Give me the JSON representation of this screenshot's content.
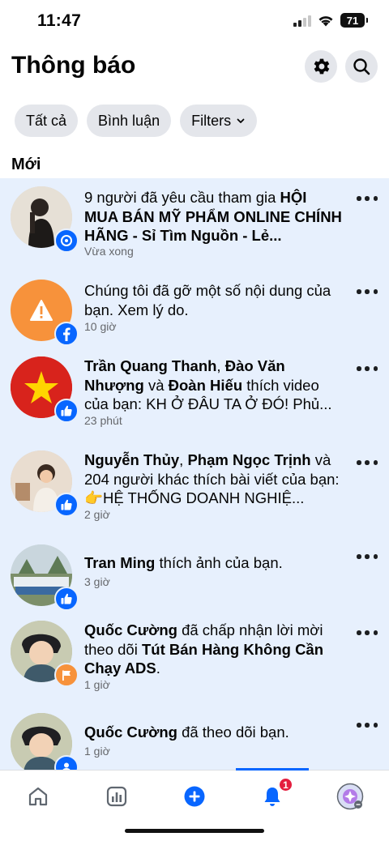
{
  "status_bar": {
    "time": "11:47",
    "battery": "71"
  },
  "header": {
    "title": "Thông báo",
    "settings_icon": "gear-icon",
    "search_icon": "search-icon"
  },
  "filters": {
    "all": "Tất cả",
    "comments": "Bình luận",
    "filters": "Filters"
  },
  "section": {
    "new": "Mới"
  },
  "notifications": [
    {
      "lines": [
        "9 người đã yêu cầu tham gia <b>HỘI</b>",
        "<b>MUA BÁN MỸ PHẨM ONLINE</b>",
        "<b>CHÍNH HÃNG - Sỉ Tìm Nguồn - Lẻ...</b>"
      ],
      "plain": "9 người đã yêu cầu tham gia HỘI MUA BÁN MỸ PHẨM ONLINE CHÍNH HÃNG - Sỉ Tìm Nguồn - Lẻ...",
      "time": "Vừa xong",
      "badge": "group-icon",
      "badge_color": "#0866ff"
    },
    {
      "plain": "Chúng tôi đã gỡ một số nội dung của bạn. Xem lý do.",
      "time": "10 giờ",
      "badge": "facebook-icon",
      "badge_color": "#0866ff",
      "avatar_color": "#f7923b"
    },
    {
      "plain": "Trần Quang Thanh, Đào Văn Nhượng và Đoàn Hiếu thích video của bạn: KH Ở ĐÂU TA Ở ĐÓ! Phủ...",
      "time": "23 phút",
      "badge": "like-icon",
      "badge_color": "#0866ff"
    },
    {
      "plain": "Nguyễn Thủy, Phạm Ngọc Trịnh và 204 người khác thích bài viết của bạn: 👉HỆ THỐNG DOANH NGHIỆ...",
      "time": "2 giờ",
      "badge": "like-icon",
      "badge_color": "#0866ff"
    },
    {
      "plain": "Tran Ming thích ảnh của bạn.",
      "time": "3 giờ",
      "badge": "like-icon",
      "badge_color": "#0866ff"
    },
    {
      "plain": "Quốc Cường đã chấp nhận lời mời theo dõi Tút Bán Hàng Không Cần Chạy ADS.",
      "time": "1 giờ",
      "badge": "flag-icon",
      "badge_color": "#f7923b"
    },
    {
      "plain": "Quốc Cường đã theo dõi bạn.",
      "time": "1 giờ",
      "badge": "follow-icon",
      "badge_color": "#0866ff"
    }
  ],
  "tab_bar": {
    "home": "home-icon",
    "dashboard": "dashboard-icon",
    "create": "plus-icon",
    "notifications": "bell-icon",
    "notifications_count": "1",
    "profile": "profile-icon"
  },
  "colors": {
    "accent": "#0866ff",
    "unread_bg": "#e7f0fd",
    "badge_red": "#e41e3f",
    "warning_orange": "#f7923b"
  }
}
